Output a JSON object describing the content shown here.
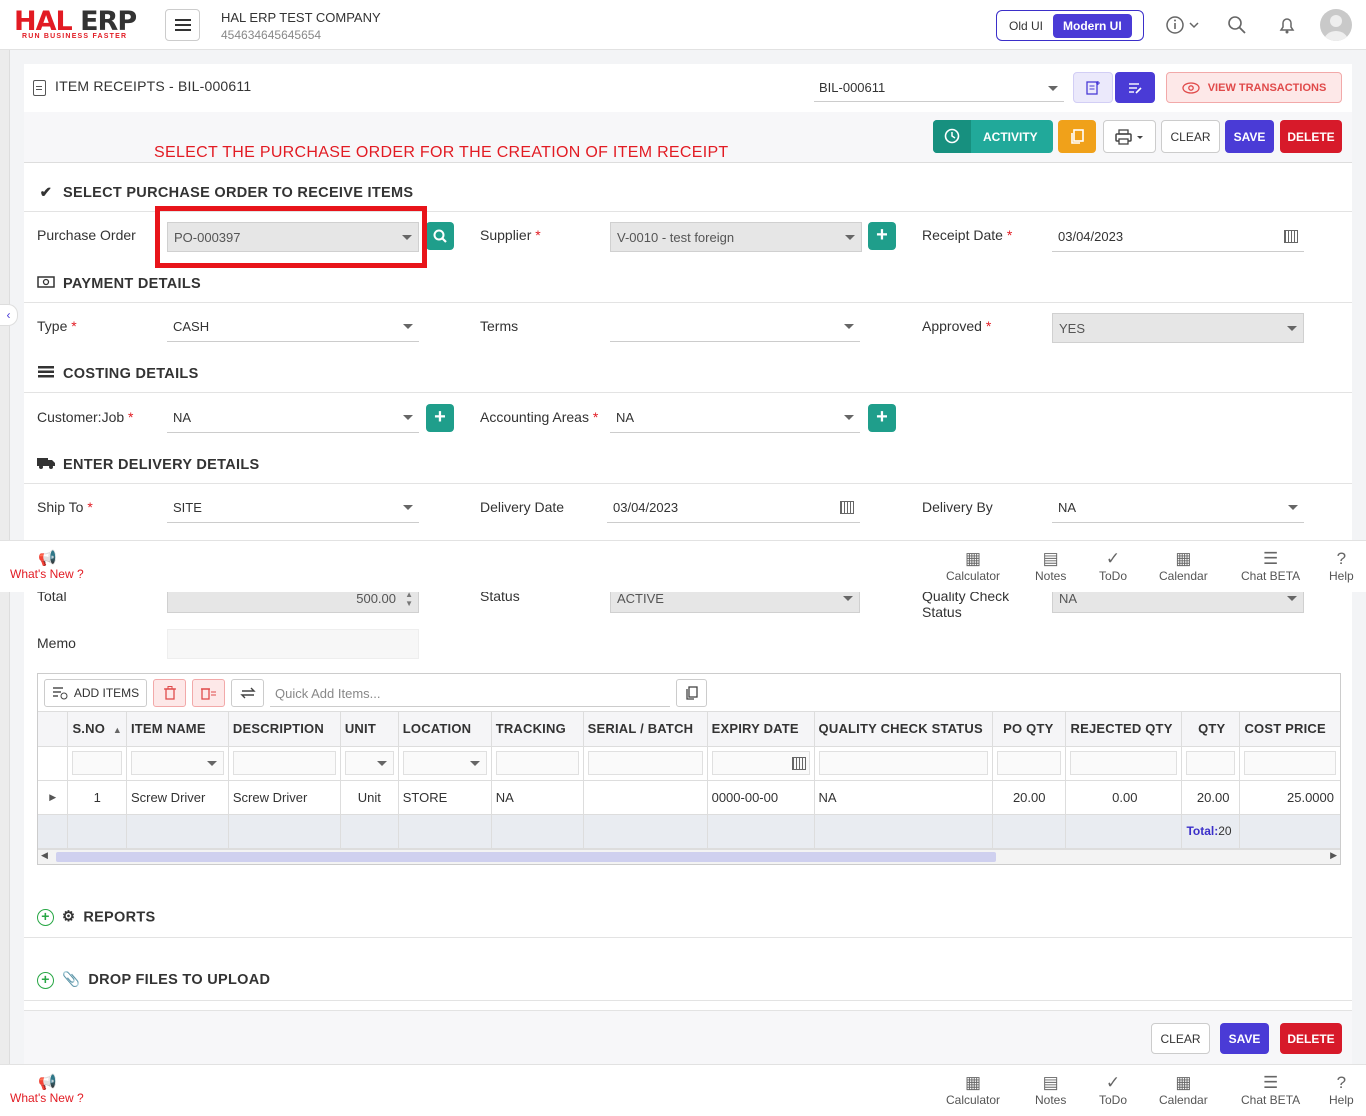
{
  "header": {
    "logo_main_left": "HAL",
    "logo_main_right": "ERP",
    "logo_tagline": "RUN BUSINESS FASTER",
    "company_name": "HAL ERP TEST COMPANY",
    "company_id": "454634645645654",
    "ui_old": "Old UI",
    "ui_modern": "Modern UI"
  },
  "page": {
    "title": "ITEM RECEIPTS - BIL-000611",
    "doc_select": "BIL-000611",
    "view_transactions": "VIEW TRANSACTIONS",
    "instruction": "SELECT THE PURCHASE ORDER FOR THE CREATION OF ITEM RECEIPT"
  },
  "toolbar": {
    "activity": "ACTIVITY",
    "clear": "CLEAR",
    "save": "SAVE",
    "delete": "DELETE"
  },
  "sections": {
    "po": "SELECT PURCHASE ORDER TO RECEIVE ITEMS",
    "payment": "PAYMENT DETAILS",
    "costing": "COSTING DETAILS",
    "delivery": "ENTER DELIVERY DETAILS",
    "reports": "REPORTS",
    "files": "DROP FILES TO UPLOAD"
  },
  "fields": {
    "purchase_order": {
      "label": "Purchase Order",
      "value": "PO-000397"
    },
    "supplier": {
      "label": "Supplier",
      "value": "V-0010 - test foreign"
    },
    "receipt_date": {
      "label": "Receipt Date",
      "value": "03/04/2023"
    },
    "type": {
      "label": "Type",
      "value": "CASH"
    },
    "terms": {
      "label": "Terms",
      "value": ""
    },
    "approved": {
      "label": "Approved",
      "value": "YES"
    },
    "customer_job": {
      "label": "Customer:Job",
      "value": "NA"
    },
    "accounting_areas": {
      "label": "Accounting Areas",
      "value": "NA"
    },
    "ship_to": {
      "label": "Ship To",
      "value": "SITE"
    },
    "delivery_date": {
      "label": "Delivery Date",
      "value": "03/04/2023"
    },
    "delivery_by": {
      "label": "Delivery By",
      "value": "NA"
    },
    "total": {
      "label": "Total",
      "value": "500.00"
    },
    "status": {
      "label": "Status",
      "value": "ACTIVE"
    },
    "qc_status": {
      "label": "Quality Check Status",
      "value": "NA"
    },
    "memo": {
      "label": "Memo",
      "value": ""
    }
  },
  "grid": {
    "add_items": "ADD ITEMS",
    "quick_add_placeholder": "Quick Add Items...",
    "columns": [
      "S.NO",
      "ITEM NAME",
      "DESCRIPTION",
      "UNIT",
      "LOCATION",
      "TRACKING",
      "SERIAL / BATCH",
      "EXPIRY DATE",
      "QUALITY CHECK STATUS",
      "PO QTY",
      "REJECTED QTY",
      "QTY",
      "COST PRICE"
    ],
    "rows": [
      {
        "sno": "1",
        "item_name": "Screw Driver",
        "description": "Screw Driver",
        "unit": "Unit",
        "location": "STORE",
        "tracking": "NA",
        "serial": "",
        "expiry": "0000-00-00",
        "qc": "NA",
        "po_qty": "20.00",
        "rejected": "0.00",
        "qty": "20.00",
        "cost": "25.0000"
      }
    ],
    "total_label": "Total:",
    "total_value": "20"
  },
  "footer_bar": {
    "whats_new": "What's New ?",
    "calculator": "Calculator",
    "notes": "Notes",
    "todo": "ToDo",
    "calendar": "Calendar",
    "chat": "Chat BETA",
    "help": "Help"
  },
  "bottom_actions": {
    "clear": "CLEAR",
    "save": "SAVE",
    "delete": "DELETE"
  },
  "colors": {
    "brand_red": "#e21b23",
    "primary": "#4a3bd6",
    "teal": "#1f9e8b",
    "delete": "#d71a2a",
    "activity": "#21a99a",
    "copy": "#f0a11a"
  }
}
